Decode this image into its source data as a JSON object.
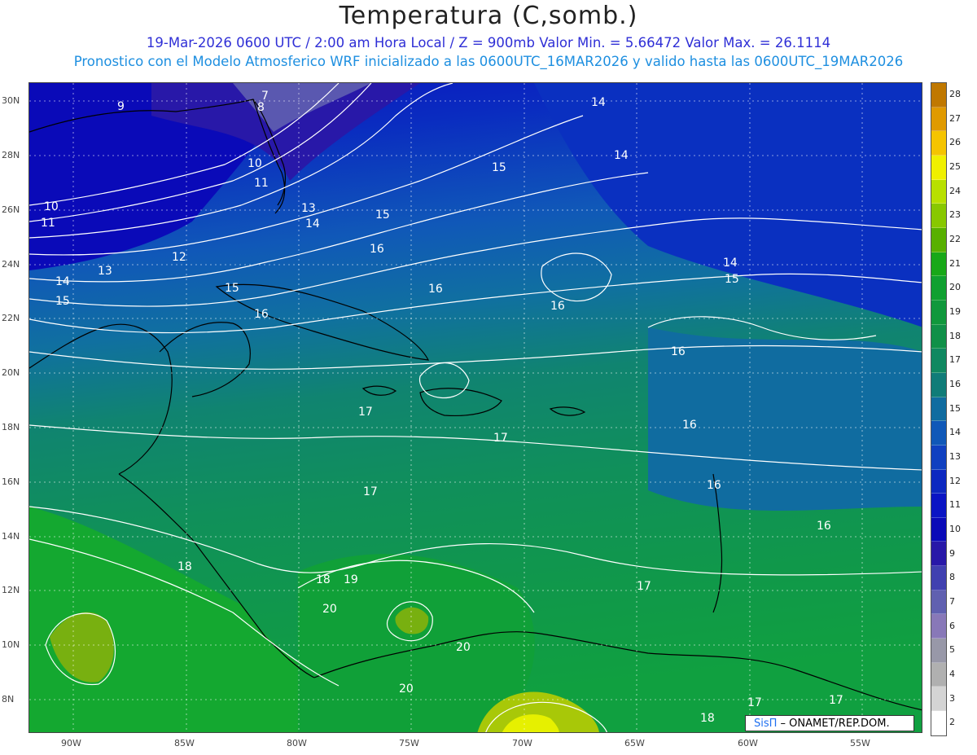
{
  "header": {
    "title": "Temperatura (C,somb.)",
    "subtitle1": "19-Mar-2026  0600 UTC / 2:00 am Hora Local / Z = 900mb     Valor Min. = 5.66472  Valor Max. = 26.1114",
    "subtitle2": "Pronostico con el Modelo Atmosferico WRF inicializado a las 0600UTC_16MAR2026 y valido hasta las  0600UTC_19MAR2026"
  },
  "map": {
    "lat_ticks": [
      "30N",
      "28N",
      "26N",
      "24N",
      "22N",
      "20N",
      "18N",
      "16N",
      "14N",
      "12N",
      "10N",
      "8N"
    ],
    "lon_ticks": [
      "90W",
      "85W",
      "80W",
      "75W",
      "70W",
      "65W",
      "60W",
      "55W"
    ],
    "contour_labels": [
      "9",
      "7",
      "8",
      "14",
      "14",
      "10",
      "11",
      "10",
      "11",
      "13",
      "14",
      "15",
      "15",
      "12",
      "16",
      "13",
      "14",
      "15",
      "15",
      "16",
      "16",
      "16",
      "14",
      "15",
      "16",
      "17",
      "17",
      "16",
      "17",
      "16",
      "16",
      "18",
      "18",
      "19",
      "20",
      "20",
      "20",
      "17",
      "17",
      "17",
      "18"
    ],
    "colors": {
      "cold": "#2818a8",
      "deep_blue": "#0a0ab8",
      "blue": "#1050c0",
      "teal": "#108878",
      "green": "#10a040",
      "bright_green": "#14b428",
      "yellow": "#e6f000",
      "contour": "#ffffff",
      "coast": "#000000"
    }
  },
  "colorbar": {
    "labels": [
      "28",
      "27",
      "26",
      "25",
      "24",
      "23",
      "22",
      "21",
      "20",
      "19",
      "18",
      "17",
      "16",
      "15",
      "14",
      "13",
      "12",
      "11",
      "10",
      "9",
      "8",
      "7",
      "6",
      "5",
      "4",
      "3",
      "2"
    ],
    "colors": [
      "#c07800",
      "#e09a00",
      "#f5c400",
      "#f0f000",
      "#b8e000",
      "#88c800",
      "#58b000",
      "#18a818",
      "#10a030",
      "#10983c",
      "#109048",
      "#108860",
      "#107c78",
      "#106ca0",
      "#1058b8",
      "#1040c0",
      "#0c28c0",
      "#0a14c4",
      "#0a0ab8",
      "#2818a8",
      "#4040b0",
      "#6060b0",
      "#8878b8",
      "#9898a8",
      "#b0b0b0",
      "#d4d4d4",
      "#ffffff"
    ]
  },
  "credit": {
    "brand": "SisΠ",
    "org": " – ONAMET/REP.DOM."
  }
}
